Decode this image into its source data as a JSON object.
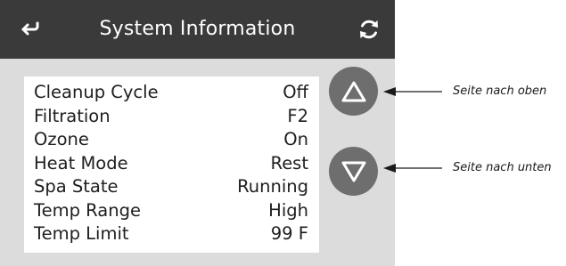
{
  "header": {
    "title": "System Information",
    "back_icon": "back-arrow-icon",
    "refresh_icon": "refresh-icon"
  },
  "info_rows": [
    {
      "label": "Cleanup Cycle",
      "value": "Off"
    },
    {
      "label": "Filtration",
      "value": "F2"
    },
    {
      "label": "Ozone",
      "value": "On"
    },
    {
      "label": "Heat Mode",
      "value": "Rest"
    },
    {
      "label": "Spa State",
      "value": "Running"
    },
    {
      "label": "Temp Range",
      "value": "High"
    },
    {
      "label": "Temp Limit",
      "value": "99 F"
    }
  ],
  "page_buttons": {
    "up_icon": "triangle-up-icon",
    "down_icon": "triangle-down-icon"
  },
  "annotations": {
    "page_up": "Seite nach oben",
    "page_down": "Seite nach unten"
  },
  "colors": {
    "header_bg": "#3a3a3a",
    "screen_bg": "#dcdcdc",
    "panel_bg": "#ffffff",
    "button_bg": "#6e6e6e",
    "icon_fg": "#ffffff"
  }
}
